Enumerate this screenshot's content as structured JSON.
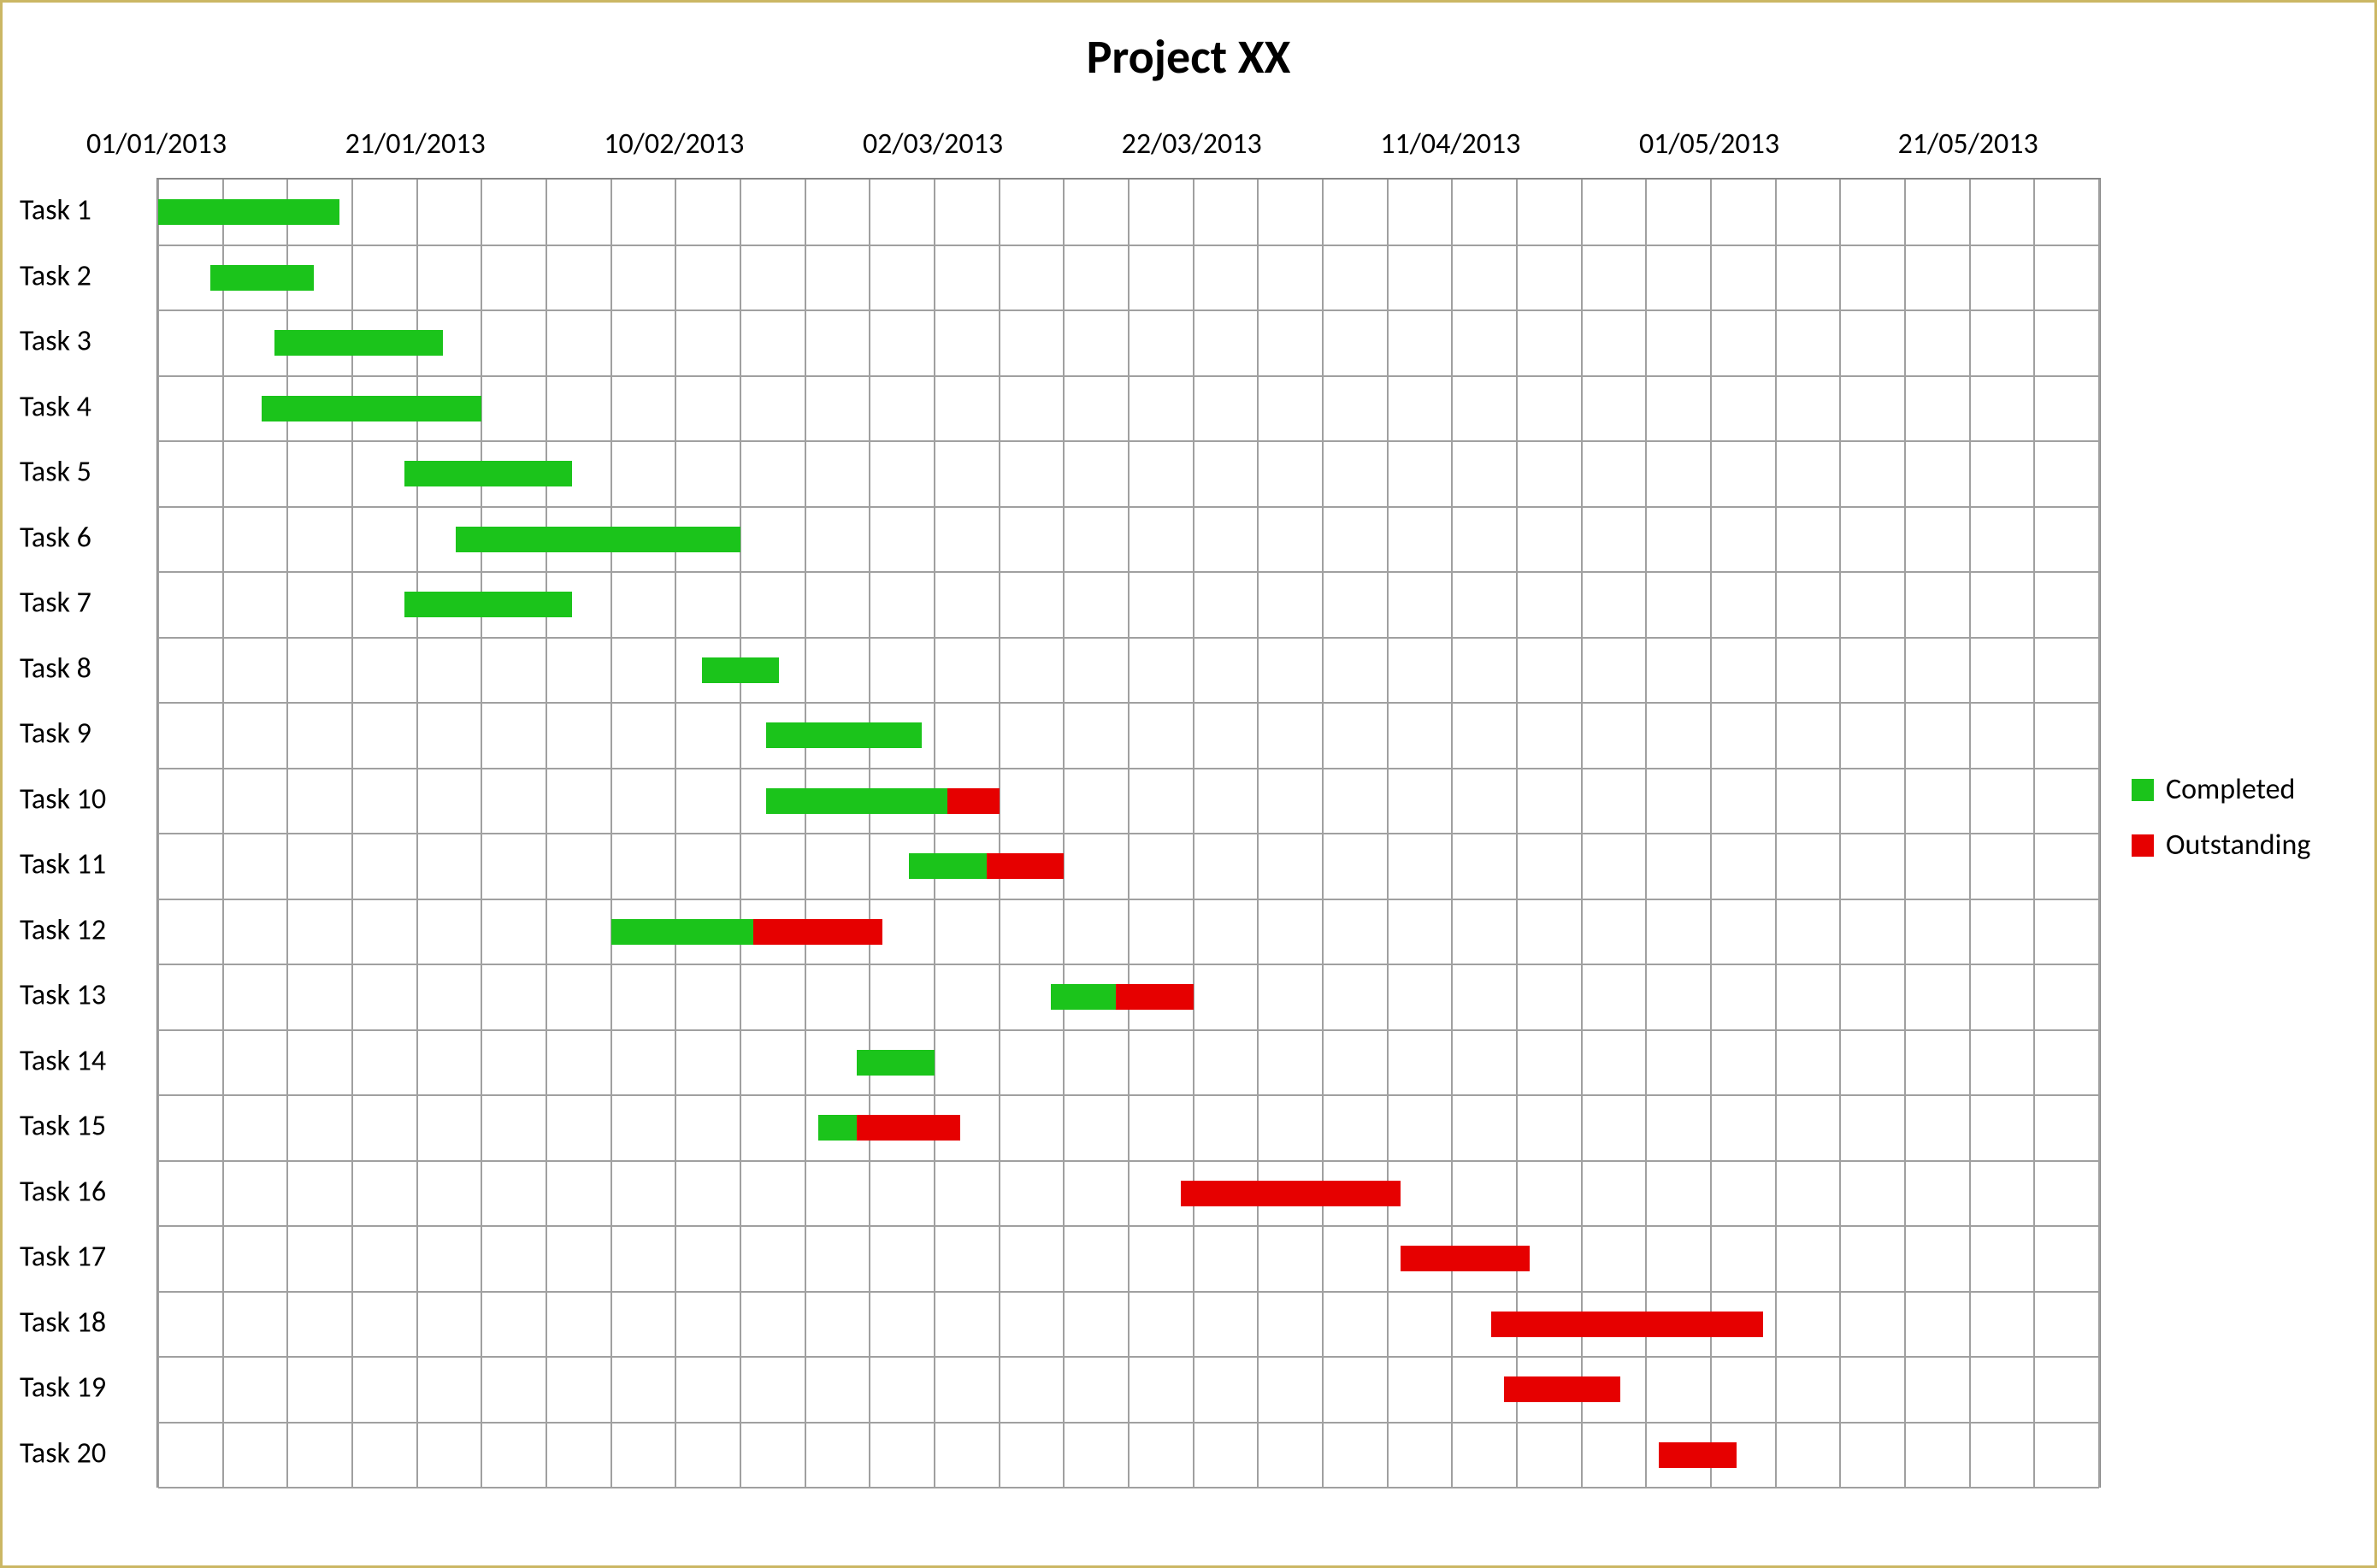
{
  "title": "Project XX",
  "legend": {
    "completed": {
      "label": "Completed",
      "color": "#1bc41b"
    },
    "outstanding": {
      "label": "Outstanding",
      "color": "#e60000"
    }
  },
  "chart_data": {
    "type": "bar",
    "orientation": "horizontal",
    "x_axis": {
      "type": "date",
      "min": "2013-01-01",
      "max": "2013-05-31",
      "ticks": [
        "01/01/2013",
        "21/01/2013",
        "10/02/2013",
        "02/03/2013",
        "22/03/2013",
        "11/04/2013",
        "01/05/2013",
        "21/05/2013"
      ],
      "tick_dates": [
        "2013-01-01",
        "2013-01-21",
        "2013-02-10",
        "2013-03-02",
        "2013-03-22",
        "2013-04-11",
        "2013-05-01",
        "2013-05-21"
      ]
    },
    "y_axis": {
      "categories": [
        "Task 1",
        "Task 2",
        "Task 3",
        "Task 4",
        "Task 5",
        "Task 6",
        "Task 7",
        "Task 8",
        "Task 9",
        "Task 10",
        "Task 11",
        "Task 12",
        "Task 13",
        "Task 14",
        "Task 15",
        "Task 16",
        "Task 17",
        "Task 18",
        "Task 19",
        "Task 20"
      ]
    },
    "series_meta": [
      {
        "name": "Completed",
        "color": "#1bc41b"
      },
      {
        "name": "Outstanding",
        "color": "#e60000"
      }
    ],
    "tasks": [
      {
        "name": "Task 1",
        "start": "2013-01-01",
        "completed_days": 14,
        "outstanding_days": 0
      },
      {
        "name": "Task 2",
        "start": "2013-01-05",
        "completed_days": 8,
        "outstanding_days": 0
      },
      {
        "name": "Task 3",
        "start": "2013-01-10",
        "completed_days": 13,
        "outstanding_days": 0
      },
      {
        "name": "Task 4",
        "start": "2013-01-09",
        "completed_days": 17,
        "outstanding_days": 0
      },
      {
        "name": "Task 5",
        "start": "2013-01-20",
        "completed_days": 13,
        "outstanding_days": 0
      },
      {
        "name": "Task 6",
        "start": "2013-01-24",
        "completed_days": 22,
        "outstanding_days": 0
      },
      {
        "name": "Task 7",
        "start": "2013-01-20",
        "completed_days": 13,
        "outstanding_days": 0
      },
      {
        "name": "Task 8",
        "start": "2013-02-12",
        "completed_days": 6,
        "outstanding_days": 0
      },
      {
        "name": "Task 9",
        "start": "2013-02-17",
        "completed_days": 12,
        "outstanding_days": 0
      },
      {
        "name": "Task 10",
        "start": "2013-02-17",
        "completed_days": 14,
        "outstanding_days": 4
      },
      {
        "name": "Task 11",
        "start": "2013-02-28",
        "completed_days": 6,
        "outstanding_days": 6
      },
      {
        "name": "Task 12",
        "start": "2013-02-05",
        "completed_days": 11,
        "outstanding_days": 10
      },
      {
        "name": "Task 13",
        "start": "2013-03-11",
        "completed_days": 5,
        "outstanding_days": 6
      },
      {
        "name": "Task 14",
        "start": "2013-02-24",
        "completed_days": 6,
        "outstanding_days": 0
      },
      {
        "name": "Task 15",
        "start": "2013-02-21",
        "completed_days": 3,
        "outstanding_days": 8
      },
      {
        "name": "Task 16",
        "start": "2013-03-21",
        "completed_days": 0,
        "outstanding_days": 17
      },
      {
        "name": "Task 17",
        "start": "2013-04-07",
        "completed_days": 0,
        "outstanding_days": 10
      },
      {
        "name": "Task 18",
        "start": "2013-04-14",
        "completed_days": 0,
        "outstanding_days": 21
      },
      {
        "name": "Task 19",
        "start": "2013-04-15",
        "completed_days": 0,
        "outstanding_days": 9
      },
      {
        "name": "Task 20",
        "start": "2013-04-27",
        "completed_days": 0,
        "outstanding_days": 6
      }
    ]
  }
}
